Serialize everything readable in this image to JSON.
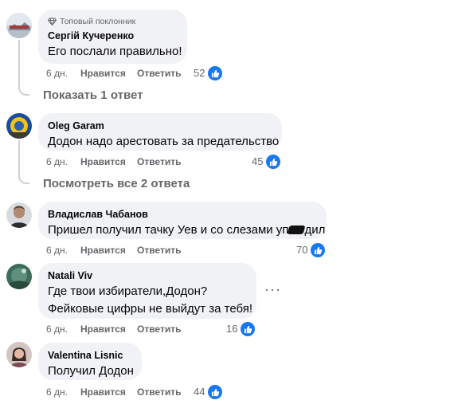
{
  "comments": [
    {
      "badge": "Топовый поклонник",
      "author": "Сергій Кучеренко",
      "text": "Его послали правильно!",
      "time": "6 дн.",
      "like": "Нравится",
      "reply": "Ответить",
      "reactions": "52",
      "replies_link": "Показать 1 ответ"
    },
    {
      "author": "Oleg Garam",
      "text": "Додон надо арестовать за предательство",
      "time": "6 дн.",
      "like": "Нравится",
      "reply": "Ответить",
      "reactions": "45",
      "replies_link": "Посмотреть все 2 ответа"
    },
    {
      "author": "Владислав Чабанов",
      "text": "Пришел получил тачку Уев и со слезами уп",
      "text_end": "дил",
      "time": "6 дн.",
      "like": "Нравится",
      "reply": "Ответить",
      "reactions": "70"
    },
    {
      "author": "Natali Viv",
      "text_line1": "Где твои избиратели,Додон?",
      "text_line2": "Фейковые цифры не выйдут за тебя!",
      "time": "6 дн.",
      "like": "Нравится",
      "reply": "Ответить",
      "reactions": "16",
      "more": "···"
    },
    {
      "author": "Valentina Lisnic",
      "text": "Получил Додон",
      "time": "6 дн.",
      "like": "Нравится",
      "reply": "Ответить",
      "reactions": "44"
    }
  ]
}
